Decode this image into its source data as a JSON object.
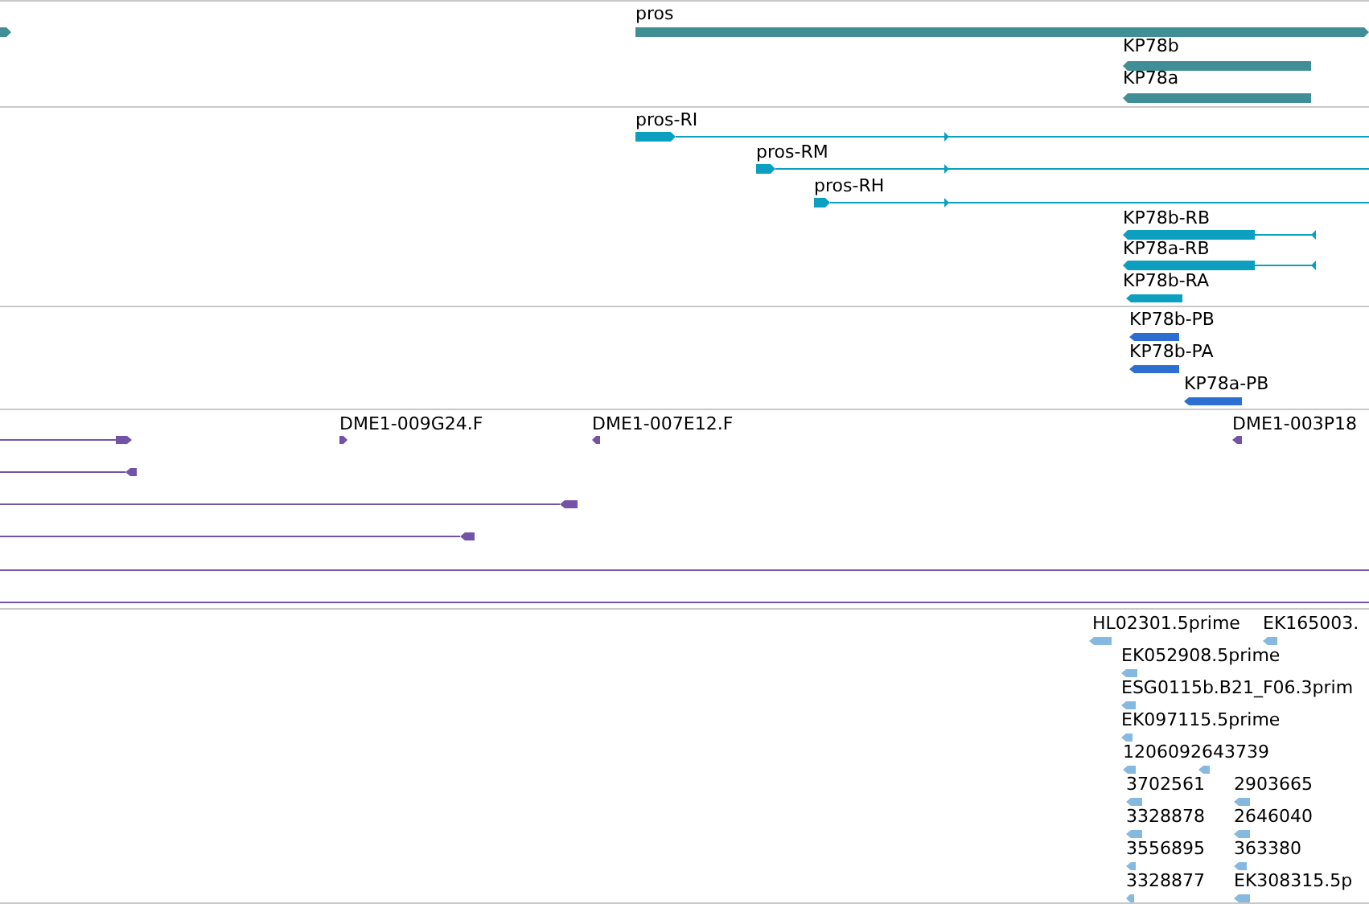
{
  "tracks": [
    {
      "color": "#408f96",
      "features": [
        {
          "kind": "arrow",
          "reverse": false
        },
        {
          "kind": "arrow",
          "label": "pros",
          "reverse": false
        },
        {
          "kind": "arrow",
          "label": "KP78b",
          "reverse": true
        },
        {
          "kind": "arrow",
          "label": "KP78a",
          "reverse": true
        }
      ]
    },
    {
      "color": "#0d9fc0",
      "features": [
        {
          "kind": "arrow",
          "label": "pros-RI",
          "reverse": false
        },
        {
          "kind": "arrow",
          "label": "pros-RM",
          "reverse": false
        },
        {
          "kind": "arrow",
          "label": "pros-RH",
          "reverse": false
        },
        {
          "kind": "arrow",
          "label": "KP78b-RB",
          "reverse": true
        },
        {
          "kind": "arrow",
          "label": "KP78a-RB",
          "reverse": true
        },
        {
          "kind": "arrow",
          "label": "KP78b-RA",
          "reverse": true
        }
      ]
    },
    {
      "color": "#2d6fd0",
      "features": [
        {
          "kind": "arrow",
          "label": "KP78b-PB",
          "reverse": true
        },
        {
          "kind": "arrow",
          "label": "KP78b-PA",
          "reverse": true
        },
        {
          "kind": "arrow",
          "label": "KP78a-PB",
          "reverse": true
        }
      ]
    },
    {
      "color": "#7352a8",
      "features": [
        {
          "kind": "arrow",
          "reverse": false
        },
        {
          "kind": "arrow",
          "label": "DME1-009G24.F",
          "reverse": false
        },
        {
          "kind": "arrow",
          "label": "DME1-007E12.F",
          "reverse": true
        },
        {
          "kind": "arrow",
          "label": "DME1-003P18",
          "reverse": true
        },
        {
          "kind": "arrow",
          "reverse": true
        },
        {
          "kind": "arrow",
          "reverse": true
        },
        {
          "kind": "arrow",
          "reverse": true
        },
        {
          "kind": "line"
        },
        {
          "kind": "line"
        }
      ]
    },
    {
      "color": "#85b9e0",
      "features": [
        {
          "kind": "arrow",
          "label": "HL02301.5prime",
          "reverse": true
        },
        {
          "kind": "arrow",
          "label": "EK165003.",
          "reverse": true
        },
        {
          "kind": "arrow",
          "label": "EK052908.5prime",
          "reverse": true
        },
        {
          "kind": "arrow",
          "label": "ESG0115b.B21_F06.3prim",
          "reverse": true
        },
        {
          "kind": "arrow",
          "label": "EK097115.5prime",
          "reverse": true
        },
        {
          "kind": "arrow",
          "label": "1206092643739",
          "reverse": true
        },
        {
          "kind": "arrow",
          "reverse": true
        },
        {
          "kind": "arrow",
          "label": "3702561",
          "reverse": true
        },
        {
          "kind": "arrow",
          "label": "2903665",
          "reverse": true
        },
        {
          "kind": "arrow",
          "label": "3328878",
          "reverse": true
        },
        {
          "kind": "arrow",
          "label": "2646040",
          "reverse": true
        },
        {
          "kind": "arrow",
          "label": "3556895",
          "reverse": true
        },
        {
          "kind": "arrow",
          "label": "363380",
          "reverse": true
        },
        {
          "kind": "arrow",
          "label": "3328877",
          "reverse": true
        },
        {
          "kind": "arrow",
          "label": "EK308315.5p",
          "reverse": true
        }
      ]
    }
  ]
}
